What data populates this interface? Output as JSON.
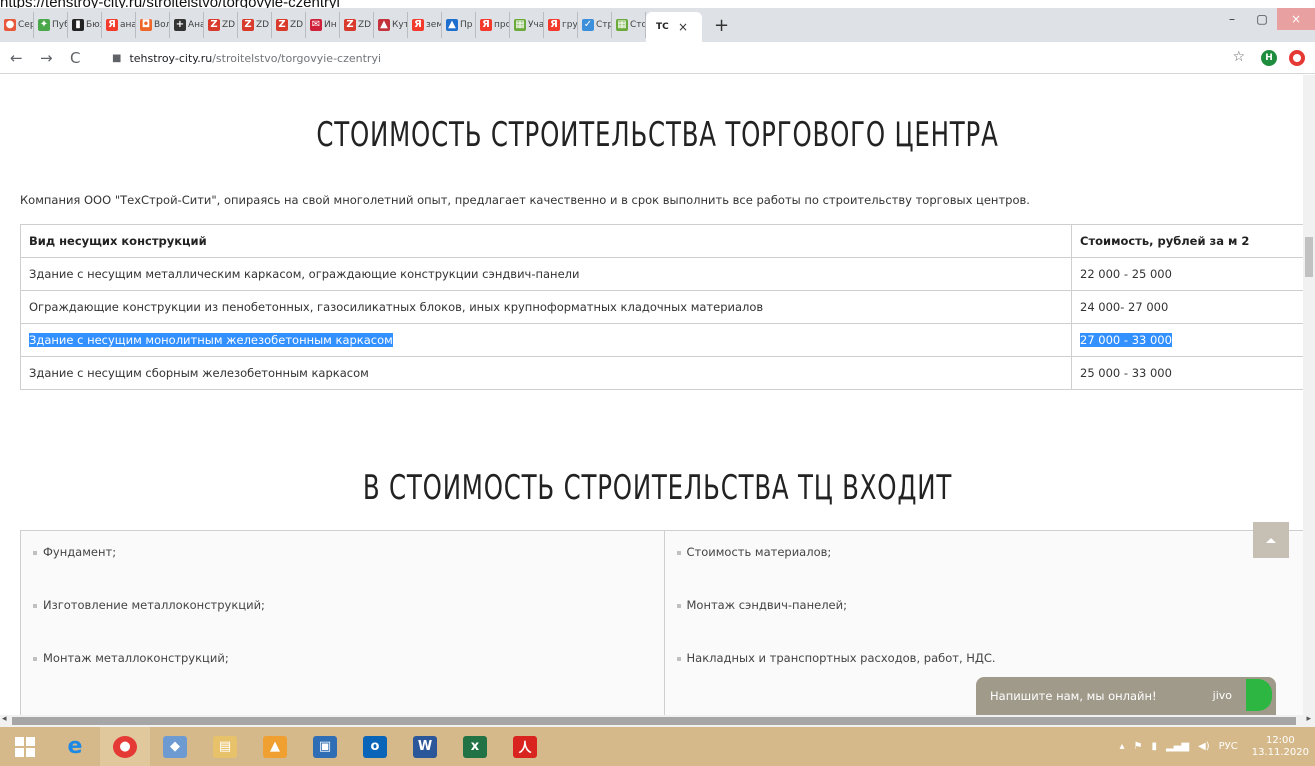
{
  "top_url_text": "https://tehstroy-city.ru/stroitelstvo/torgovyie-czentryi",
  "tabs": [
    {
      "label": "Сер",
      "icon": "map-pin-icon",
      "color": "#e8593b",
      "glyph": "●"
    },
    {
      "label": "Пуб",
      "icon": "palm-icon",
      "color": "#4aa84a",
      "glyph": "✦"
    },
    {
      "label": "Бюз",
      "icon": "pen-icon",
      "color": "#222222",
      "glyph": "▮"
    },
    {
      "label": "ана",
      "icon": "yandex-icon",
      "color": "#f33a2c",
      "glyph": "Я"
    },
    {
      "label": "Вол",
      "icon": "video-icon",
      "color": "#f0662a",
      "glyph": "◘"
    },
    {
      "label": "Ана",
      "icon": "plus-square-icon",
      "color": "#333333",
      "glyph": "+"
    },
    {
      "label": "ZD",
      "icon": "zen-icon",
      "color": "#d83a2b",
      "glyph": "Z"
    },
    {
      "label": "ZD",
      "icon": "zen-icon",
      "color": "#d83a2b",
      "glyph": "Z"
    },
    {
      "label": "ZD",
      "icon": "zen-icon",
      "color": "#d83a2b",
      "glyph": "Z"
    },
    {
      "label": "Ин",
      "icon": "mail-icon",
      "color": "#d0213b",
      "glyph": "✉"
    },
    {
      "label": "ZD",
      "icon": "zen-icon",
      "color": "#d83a2b",
      "glyph": "Z"
    },
    {
      "label": "Кут",
      "icon": "bird-icon",
      "color": "#c2333c",
      "glyph": "▲"
    },
    {
      "label": "зем",
      "icon": "yandex-icon",
      "color": "#f33a2c",
      "glyph": "Я"
    },
    {
      "label": "Пр",
      "icon": "mountain-icon",
      "color": "#1f6fcf",
      "glyph": "▲"
    },
    {
      "label": "прс",
      "icon": "yandex-icon",
      "color": "#f33a2c",
      "glyph": "Я"
    },
    {
      "label": "Уча",
      "icon": "grid-icon",
      "color": "#6aaa3a",
      "glyph": "▦"
    },
    {
      "label": "гру",
      "icon": "yandex-icon",
      "color": "#f33a2c",
      "glyph": "Я"
    },
    {
      "label": "Стр",
      "icon": "check-circle-icon",
      "color": "#3b8fdb",
      "glyph": "✓"
    },
    {
      "label": "Стс",
      "icon": "grid-icon",
      "color": "#6aaa3a",
      "glyph": "▦"
    }
  ],
  "active_tab": {
    "label": "ТС",
    "close": "×"
  },
  "new_tab": "+",
  "window_controls": {
    "minimize": "–",
    "maximize": "▢",
    "close": "×"
  },
  "address": {
    "host": "tehstroy-city.ru",
    "path": "/stroitelstvo/torgovyie-czentryi"
  },
  "ext_h": "H",
  "title_main": "СТОИМОСТЬ СТРОИТЕЛЬСТВА ТОРГОВОГО ЦЕНТРА",
  "intro": "Компания ООО \"ТехСтрой-Сити\", опираясь на свой многолетний опыт, предлагает качественно и в срок выполнить все работы по строительству торговых центров.",
  "price_table": {
    "headers": [
      "Вид несущих конструкций",
      "Стоимость, рублей за м 2"
    ],
    "rows": [
      [
        "Здание с несущим металлическим каркасом, ограждающие конструкции сэндвич-панели",
        "22 000 - 25 000"
      ],
      [
        "Ограждающие конструкции из пенобетонных, газосиликатных блоков, иных крупноформатных кладочных материалов",
        "24 000- 27 000"
      ],
      [
        "Здание с несущим монолитным железобетонным каркасом",
        "27 000 - 33 000"
      ],
      [
        "Здание с несущим сборным железобетонным каркасом",
        "25 000 - 33 000"
      ]
    ]
  },
  "title_included": "В СТОИМОСТЬ СТРОИТЕЛЬСТВА ТЦ ВХОДИТ",
  "included": {
    "left": [
      "Фундамент;",
      "Изготовление металлоконструкций;",
      "Монтаж металлоконструкций;"
    ],
    "right": [
      "Стоимость материалов;",
      "Монтаж сэндвич-панелей;",
      "Накладных и транспортных расходов, работ, НДС."
    ]
  },
  "chat": {
    "label": "Напишите нам, мы онлайн!",
    "brand": "jivo"
  },
  "tray": {
    "lang": "РУС",
    "time": "12:00",
    "date": "13.11.2020"
  }
}
